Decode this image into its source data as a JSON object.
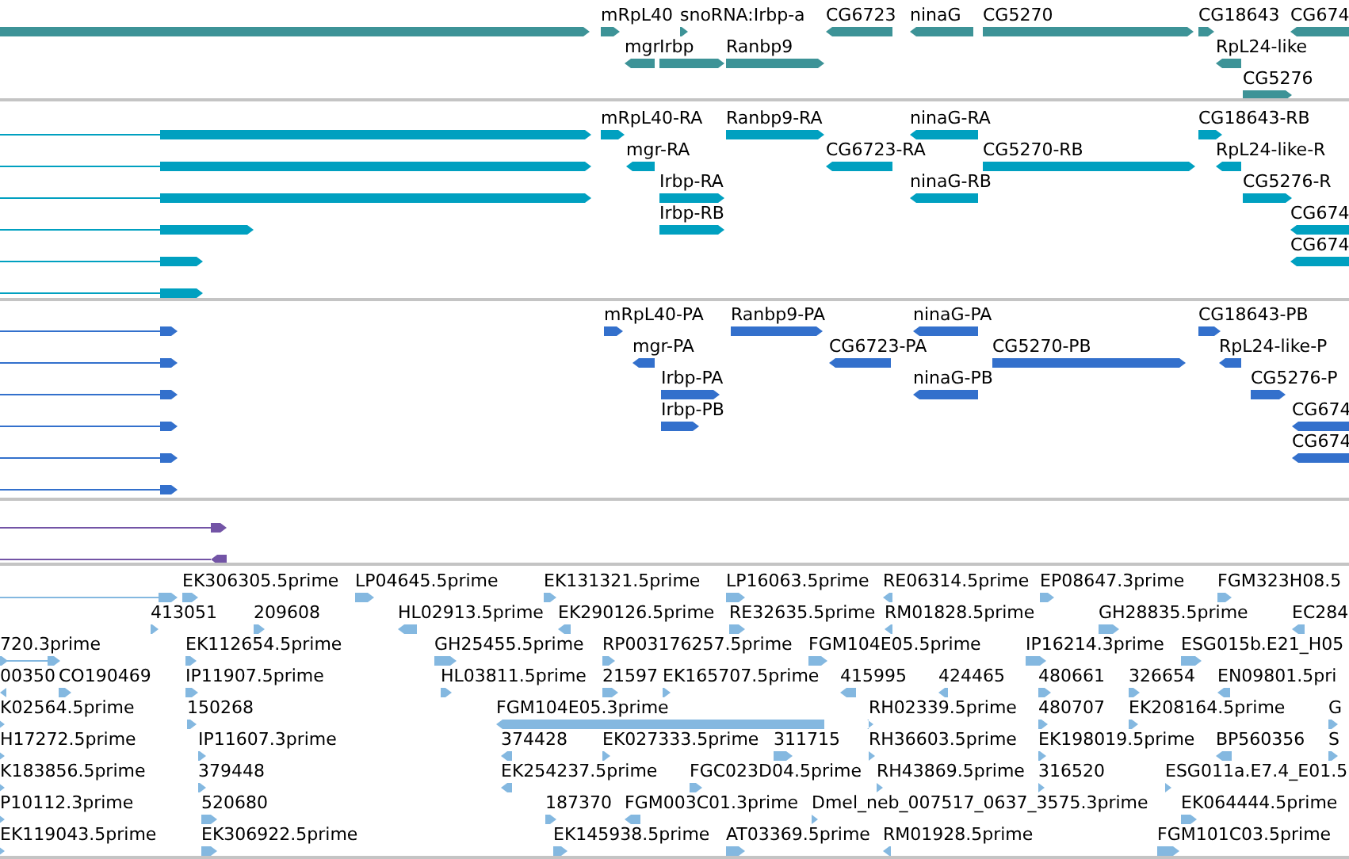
{
  "tracks": [
    {
      "kind": "gene",
      "features": [
        {
          "reverse": false
        },
        {
          "label": "mRpL40",
          "reverse": false
        },
        {
          "label": "snoRNA:Irbp-a",
          "reverse": false
        },
        {
          "label": "CG6723",
          "reverse": true
        },
        {
          "label": "ninaG",
          "reverse": true
        },
        {
          "label": "CG5270",
          "reverse": false
        },
        {
          "label": "CG18643",
          "reverse": false
        },
        {
          "label": "CG674",
          "reverse": true
        },
        {
          "label": "mgr",
          "reverse": true
        },
        {
          "label": "Irbp",
          "reverse": false
        },
        {
          "label": "Ranbp9",
          "reverse": false
        },
        {
          "label": "RpL24-like",
          "reverse": true
        },
        {
          "label": "CG5276",
          "reverse": false
        }
      ]
    },
    {
      "kind": "transcript",
      "features": [
        {
          "reverse": false
        },
        {
          "reverse": false
        },
        {
          "reverse": false
        },
        {
          "reverse": false
        },
        {
          "reverse": false
        },
        {
          "reverse": false
        },
        {
          "label": "mRpL40-RA",
          "reverse": false
        },
        {
          "label": "Ranbp9-RA",
          "reverse": false
        },
        {
          "label": "ninaG-RA",
          "reverse": true
        },
        {
          "label": "CG18643-RB",
          "reverse": false
        },
        {
          "label": "mgr-RA",
          "reverse": true
        },
        {
          "label": "CG6723-RA",
          "reverse": true
        },
        {
          "label": "CG5270-RB",
          "reverse": false
        },
        {
          "label": "RpL24-like-R",
          "reverse": true
        },
        {
          "label": "Irbp-RA",
          "reverse": false
        },
        {
          "label": "ninaG-RB",
          "reverse": true
        },
        {
          "label": "CG5276-R",
          "reverse": false
        },
        {
          "label": "Irbp-RB",
          "reverse": false
        },
        {
          "label": "CG674",
          "reverse": true
        },
        {
          "label": "CG674",
          "reverse": true
        }
      ]
    },
    {
      "kind": "protein",
      "features": [
        {
          "reverse": false
        },
        {
          "reverse": false
        },
        {
          "reverse": false
        },
        {
          "reverse": false
        },
        {
          "reverse": false
        },
        {
          "reverse": false
        },
        {
          "label": "mRpL40-PA",
          "reverse": false
        },
        {
          "label": "Ranbp9-PA",
          "reverse": false
        },
        {
          "label": "ninaG-PA",
          "reverse": true
        },
        {
          "label": "CG18643-PB",
          "reverse": false
        },
        {
          "label": "mgr-PA",
          "reverse": true
        },
        {
          "label": "CG6723-PA",
          "reverse": true
        },
        {
          "label": "CG5270-PB",
          "reverse": false
        },
        {
          "label": "RpL24-like-P",
          "reverse": true
        },
        {
          "label": "Irbp-PA",
          "reverse": false
        },
        {
          "label": "ninaG-PB",
          "reverse": true
        },
        {
          "label": "CG5276-P",
          "reverse": false
        },
        {
          "label": "Irbp-PB",
          "reverse": false
        },
        {
          "label": "CG674",
          "reverse": true
        },
        {
          "label": "CG674",
          "reverse": true
        }
      ]
    },
    {
      "kind": "other",
      "features": [
        {
          "reverse": false
        },
        {
          "reverse": true
        }
      ]
    },
    {
      "kind": "est",
      "features": [
        {
          "reverse": false
        },
        {
          "label": "EK306305.5prime",
          "reverse": false
        },
        {
          "label": "LP04645.5prime",
          "reverse": false
        },
        {
          "label": "EK131321.5prime",
          "reverse": false
        },
        {
          "label": "LP16063.5prime",
          "reverse": false
        },
        {
          "label": "RE06314.5prime",
          "reverse": true
        },
        {
          "label": "EP08647.3prime",
          "reverse": false
        },
        {
          "label": "FGM323H08.5",
          "reverse": false
        },
        {
          "label": "413051",
          "reverse": false
        },
        {
          "label": "209608",
          "reverse": false
        },
        {
          "label": "HL02913.5prime",
          "reverse": true
        },
        {
          "label": "EK290126.5prime",
          "reverse": true
        },
        {
          "label": "RE32635.5prime",
          "reverse": false
        },
        {
          "label": "RM01828.5prime",
          "reverse": true
        },
        {
          "label": "GH28835.5prime",
          "reverse": false
        },
        {
          "label": "EC284",
          "reverse": true
        },
        {
          "reverse": false
        },
        {
          "label": "720.3prime",
          "reverse": false
        },
        {
          "label": "EK112654.5prime",
          "reverse": false
        },
        {
          "label": "GH25455.5prime",
          "reverse": false
        },
        {
          "label": "RP003176257.5prime",
          "reverse": false
        },
        {
          "label": "FGM104E05.5prime",
          "reverse": false
        },
        {
          "label": "IP16214.3prime",
          "reverse": false
        },
        {
          "label": "ESG015b.E21_H05",
          "reverse": false
        },
        {
          "label": "00350",
          "reverse": true
        },
        {
          "label": "CO190469",
          "reverse": false
        },
        {
          "label": "IP11907.5prime",
          "reverse": false
        },
        {
          "label": "HL03811.5prime",
          "reverse": false
        },
        {
          "label": "21597",
          "reverse": false
        },
        {
          "label": "EK165707.5prime",
          "reverse": false
        },
        {
          "label": "415995",
          "reverse": true
        },
        {
          "label": "424465",
          "reverse": true
        },
        {
          "label": "480661",
          "reverse": false
        },
        {
          "label": "326654",
          "reverse": false
        },
        {
          "label": "EN09801.5pri",
          "reverse": true
        },
        {
          "label": "K02564.5prime",
          "reverse": false
        },
        {
          "label": "150268",
          "reverse": false
        },
        {
          "label": "FGM104E05.3prime",
          "reverse": true
        },
        {
          "label": "RH02339.5prime",
          "reverse": false
        },
        {
          "label": "480707",
          "reverse": false
        },
        {
          "label": "EK208164.5prime",
          "reverse": false
        },
        {
          "label": "G",
          "reverse": false
        },
        {
          "label": "H17272.5prime",
          "reverse": false
        },
        {
          "label": "IP11607.3prime",
          "reverse": false
        },
        {
          "label": "374428",
          "reverse": true
        },
        {
          "label": "EK027333.5prime",
          "reverse": false
        },
        {
          "label": "311715",
          "reverse": false
        },
        {
          "label": "RH36603.5prime",
          "reverse": false
        },
        {
          "label": "EK198019.5prime",
          "reverse": false
        },
        {
          "label": "BP560356",
          "reverse": true
        },
        {
          "label": "S",
          "reverse": false
        },
        {
          "label": "K183856.5prime",
          "reverse": false
        },
        {
          "label": "379448",
          "reverse": false
        },
        {
          "label": "EK254237.5prime",
          "reverse": true
        },
        {
          "label": "FGC023D04.5prime",
          "reverse": false
        },
        {
          "label": "RH43869.5prime",
          "reverse": false
        },
        {
          "label": "316520",
          "reverse": false
        },
        {
          "label": "ESG011a.E7.4_E01.5",
          "reverse": false
        },
        {
          "label": "P10112.3prime",
          "reverse": false
        },
        {
          "label": "520680",
          "reverse": false
        },
        {
          "label": "187370",
          "reverse": false
        },
        {
          "label": "FGM003C01.3prime",
          "reverse": true
        },
        {
          "label": "Dmel_neb_007517_0637_3575.3prime",
          "reverse": false
        },
        {
          "label": "EK064444.5prime",
          "reverse": false
        },
        {
          "label": "EK119043.5prime",
          "reverse": false
        },
        {
          "label": "EK306922.5prime",
          "reverse": false
        },
        {
          "label": "EK145938.5prime",
          "reverse": false
        },
        {
          "label": "AT03369.5prime",
          "reverse": false
        },
        {
          "label": "RM01928.5prime",
          "reverse": true
        },
        {
          "label": "FGM101C03.5prime",
          "reverse": false
        }
      ]
    }
  ]
}
